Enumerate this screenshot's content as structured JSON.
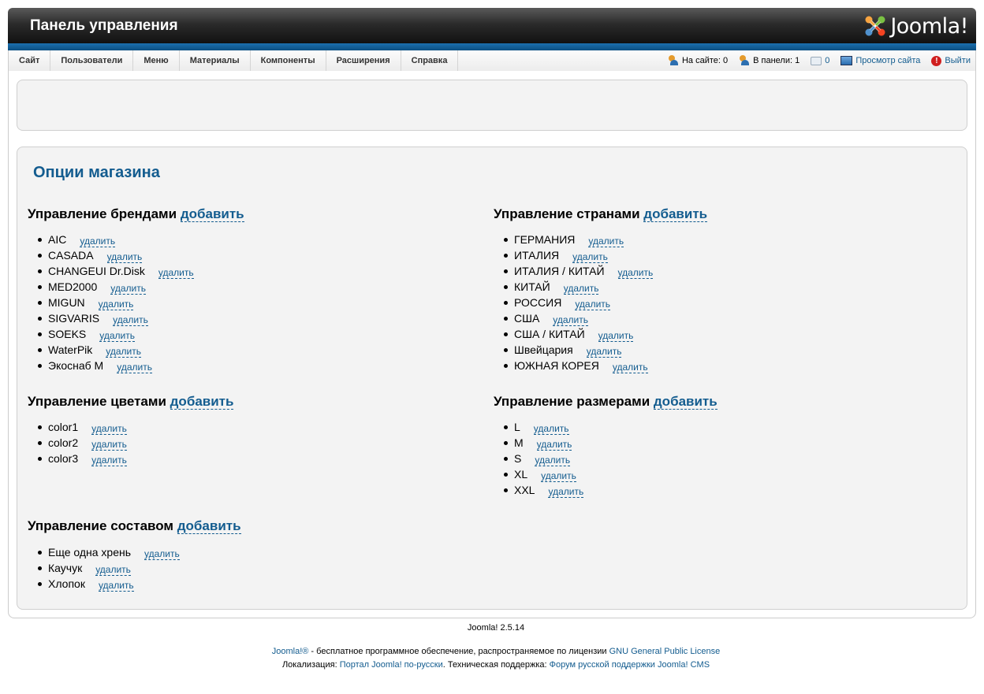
{
  "header": {
    "title": "Панель управления",
    "logo_text": "Joomla!"
  },
  "menu": [
    "Сайт",
    "Пользователи",
    "Меню",
    "Материалы",
    "Компоненты",
    "Расширения",
    "Справка"
  ],
  "status": {
    "on_site": "На сайте: 0",
    "in_panel": "В панели: 1",
    "messages": "0",
    "view_site": "Просмотр сайта",
    "logout": "Выйти"
  },
  "main": {
    "title": "Опции магазина",
    "add_label": "добавить",
    "delete_label": "удалить",
    "sections": {
      "brands": {
        "title": "Управление брендами",
        "items": [
          "AIC",
          "CASADA",
          "CHANGEUI Dr.Disk",
          "MED2000",
          "MIGUN",
          "SIGVARIS",
          "SOEKS",
          "WaterPik",
          "Экоснаб М"
        ]
      },
      "countries": {
        "title": "Управление странами",
        "items": [
          "ГЕРМАНИЯ",
          "ИТАЛИЯ",
          "ИТАЛИЯ / КИТАЙ",
          "КИТАЙ",
          "РОССИЯ",
          "США",
          "США / КИТАЙ",
          "Швейцария",
          "ЮЖНАЯ КОРЕЯ"
        ]
      },
      "colors": {
        "title": "Управление цветами",
        "items": [
          "color1",
          "color2",
          "color3"
        ]
      },
      "sizes": {
        "title": "Управление размерами",
        "items": [
          "L",
          "M",
          "S",
          "XL",
          "XXL"
        ]
      },
      "materials": {
        "title": "Управление составом",
        "items": [
          "Еще одна хрень",
          "Каучук",
          "Хлопок"
        ]
      }
    }
  },
  "footer": {
    "version": "Joomla! 2.5.14",
    "line1_link1": "Joomla!®",
    "line1_text": " - бесплатное программное обеспечение, распространяемое по лицензии ",
    "line1_link2": "GNU General Public License",
    "line2_text1": "Локализация: ",
    "line2_link1": "Портал Joomla! по-русски",
    "line2_text2": ". Техническая поддержка: ",
    "line2_link2": "Форум русской поддержки Joomla! CMS"
  }
}
